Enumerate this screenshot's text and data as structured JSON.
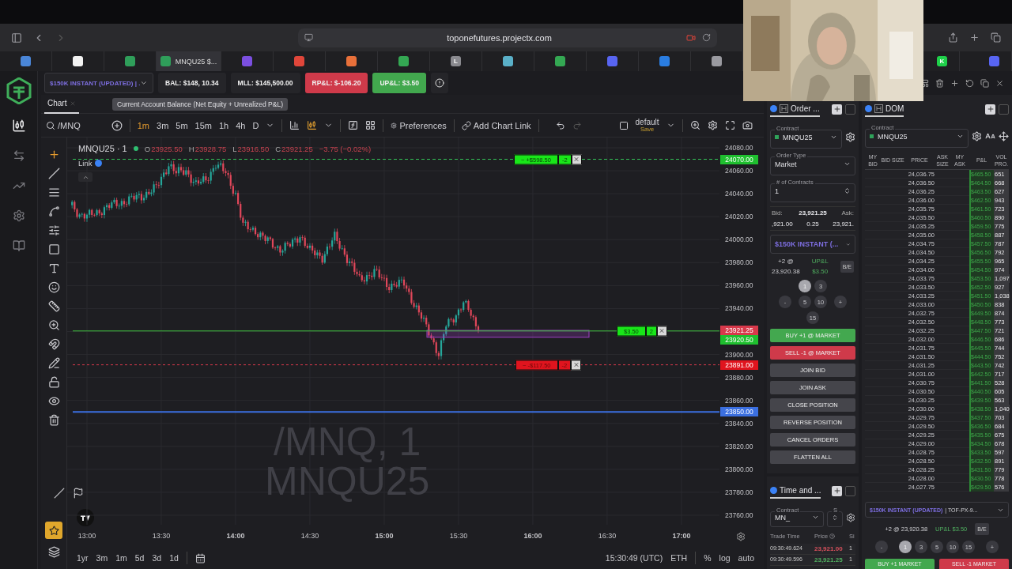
{
  "browser": {
    "url": "toponefutures.projectx.com",
    "tabs": [
      {
        "color": "#4a86d8",
        "selected": false
      },
      {
        "color": "#f2f2f2",
        "selected": false
      },
      {
        "color": "#2f9e5a",
        "selected": false
      },
      {
        "color": "#2f9e5a",
        "label": "MNQU25 $...",
        "selected": true
      },
      {
        "color": "#7b4fe0",
        "selected": false
      },
      {
        "color": "#e0463a",
        "selected": false
      },
      {
        "color": "#e8703a",
        "selected": false
      },
      {
        "color": "#34a853",
        "selected": false
      },
      {
        "color": "#8a8a8f",
        "label": "L",
        "selected": false
      },
      {
        "color": "#5ab0c8",
        "selected": false
      },
      {
        "color": "#34a853",
        "selected": false
      },
      {
        "color": "#5865f2",
        "selected": false
      },
      {
        "color": "#2a7de1",
        "selected": false
      },
      {
        "color": "#9a9aa0",
        "selected": false
      }
    ],
    "pinned_tabs": [
      {
        "color": "#1fd14a",
        "label": "K",
        "selected": false
      },
      {
        "color": "#5865f2",
        "selected": false
      }
    ]
  },
  "account_bar": {
    "account": "$150K INSTANT (UPDATED) | .",
    "stats": [
      {
        "text": "BAL: $148, 10.34",
        "kind": "neutral"
      },
      {
        "text": "MLL: $145,500.00",
        "kind": "neutral"
      },
      {
        "text": "RP&L: $-106.20",
        "kind": "loss"
      },
      {
        "text": "UP&L: $3.50",
        "kind": "profit"
      }
    ]
  },
  "tooltip": "Current Account Balance (Net Equity + Unrealized P&L)",
  "chart": {
    "tab": "Chart",
    "symbol": "/MNQ",
    "timeframes": [
      {
        "label": "1m",
        "selected": true
      },
      {
        "label": "3m",
        "selected": false
      },
      {
        "label": "5m",
        "selected": false
      },
      {
        "label": "15m",
        "selected": false
      },
      {
        "label": "1h",
        "selected": false
      },
      {
        "label": "4h",
        "selected": false
      },
      {
        "label": "D",
        "selected": false
      }
    ],
    "preferences": "Preferences",
    "chart_link": "Add Chart Link",
    "layout": "default",
    "layout_hint": "Save",
    "legend": {
      "title": "MNQU25 · 1",
      "values": [
        {
          "key": "O",
          "value": "23925.50"
        },
        {
          "key": "H",
          "value": "23928.75"
        },
        {
          "key": "L",
          "value": "23916.50"
        },
        {
          "key": "C",
          "value": "23921.25"
        }
      ],
      "change": "−3.75 (−0.02%)",
      "link": "Link"
    },
    "watermark": [
      "/MNQ, 1",
      "MNQU25"
    ],
    "lines": [
      {
        "kind": "target",
        "tag": "24070.00",
        "label": "~ +$598.50",
        "qty": "-2"
      },
      {
        "kind": "last",
        "tag": "23921.25"
      },
      {
        "kind": "position",
        "tag": "23920.50",
        "label": "$3.50",
        "qty": "2"
      },
      {
        "kind": "stop",
        "tag": "23891.00",
        "label": "~ -$117.50",
        "qty": "-2"
      },
      {
        "kind": "level",
        "tag": "23850.00"
      }
    ],
    "price_axis": [
      "24080.00",
      "24060.00",
      "24040.00",
      "24020.00",
      "24000.00",
      "23980.00",
      "23960.00",
      "23940.00",
      "23900.00",
      "23880.00",
      "23860.00",
      "23840.00",
      "23820.00",
      "23800.00",
      "23780.00",
      "23760.00"
    ],
    "time_axis": [
      {
        "label": "13:00",
        "kind": "minor"
      },
      {
        "label": "13:30",
        "kind": "minor"
      },
      {
        "label": "14:00",
        "kind": "major"
      },
      {
        "label": "14:30",
        "kind": "minor"
      },
      {
        "label": "15:00",
        "kind": "major"
      },
      {
        "label": "15:30",
        "kind": "minor"
      },
      {
        "label": "16:00",
        "kind": "major"
      },
      {
        "label": "16:30",
        "kind": "minor"
      },
      {
        "label": "17:00",
        "kind": "major"
      }
    ],
    "ranges": [
      "1yr",
      "3m",
      "1m",
      "5d",
      "3d",
      "1d"
    ],
    "clock": "15:30:49 (UTC)",
    "session": "ETH",
    "scale_options": [
      "%",
      "log",
      "auto"
    ]
  },
  "order": {
    "tab": "Order ...",
    "contract_label": "Contract",
    "contract": "MNQU25",
    "type_label": "Order Type",
    "type": "Market",
    "qty_label": "# of Contracts",
    "qty": "1",
    "bid_label": "Bid:",
    "bid": ",921.00",
    "mid": "23,921.25",
    "spread": "0.25",
    "ask_label": "Ask:",
    "ask": "23,921.",
    "account": "$150K INSTANT (...",
    "position": "+2 @",
    "position_price": "23,920.38",
    "upl_label": "UP&L",
    "upl": "$3.50",
    "breakeven": "B/E",
    "quantities": [
      {
        "label": "1",
        "selected": true
      },
      {
        "label": "3",
        "selected": false
      },
      {
        "label": "5",
        "selected": false
      },
      {
        "label": "10",
        "selected": false
      },
      {
        "label": "15",
        "selected": false
      }
    ],
    "stepper": [
      "-",
      "+"
    ],
    "actions": [
      {
        "label": "BUY +1 @ MARKET",
        "kind": "buy"
      },
      {
        "label": "SELL -1 @ MARKET",
        "kind": "sell"
      },
      {
        "label": "JOIN BID",
        "kind": "plain"
      },
      {
        "label": "JOIN ASK",
        "kind": "plain"
      },
      {
        "label": "CLOSE POSITION",
        "kind": "plain"
      },
      {
        "label": "REVERSE POSITION",
        "kind": "plain"
      },
      {
        "label": "CANCEL ORDERS",
        "kind": "plain"
      },
      {
        "label": "FLATTEN ALL",
        "kind": "plain"
      }
    ]
  },
  "time_and_sales": {
    "tab": "Time and ...",
    "contract_label": "Contract",
    "contract": "MN_",
    "size_label": "S",
    "columns": [
      "Trade Time",
      "Price",
      "Si"
    ],
    "rows": [
      {
        "time": "09:30:49.624",
        "price": "23,921.00",
        "color": "#d8505c",
        "size": "1"
      },
      {
        "time": "09:30:49.596",
        "price": "23,921.25",
        "color": "#4fae5f",
        "size": "1"
      }
    ]
  },
  "dom": {
    "tab": "DOM",
    "contract_label": "Contract",
    "contract": "MNQU25",
    "columns": [
      "MY BID",
      "BID SIZE",
      "PRICE",
      "ASK SIZE",
      "MY ASK",
      "P&L",
      "VOL PRO."
    ],
    "rows": [
      {
        "price": "24,036.75",
        "pnl": "$465.50",
        "volume": "651"
      },
      {
        "price": "24,036.50",
        "pnl": "$464.50",
        "volume": "668"
      },
      {
        "price": "24,036.25",
        "pnl": "$463.50",
        "volume": "627"
      },
      {
        "price": "24,036.00",
        "pnl": "$462.50",
        "volume": "943"
      },
      {
        "price": "24,035.75",
        "pnl": "$461.50",
        "volume": "723"
      },
      {
        "price": "24,035.50",
        "pnl": "$460.50",
        "volume": "890"
      },
      {
        "price": "24,035.25",
        "pnl": "$459.50",
        "volume": "775"
      },
      {
        "price": "24,035.00",
        "pnl": "$458.50",
        "volume": "887"
      },
      {
        "price": "24,034.75",
        "pnl": "$457.50",
        "volume": "787"
      },
      {
        "price": "24,034.50",
        "pnl": "$456.50",
        "volume": "792"
      },
      {
        "price": "24,034.25",
        "pnl": "$455.50",
        "volume": "965"
      },
      {
        "price": "24,034.00",
        "pnl": "$454.50",
        "volume": "974"
      },
      {
        "price": "24,033.75",
        "pnl": "$453.50",
        "volume": "1,097"
      },
      {
        "price": "24,033.50",
        "pnl": "$452.50",
        "volume": "927"
      },
      {
        "price": "24,033.25",
        "pnl": "$451.50",
        "volume": "1,038"
      },
      {
        "price": "24,033.00",
        "pnl": "$450.50",
        "volume": "838"
      },
      {
        "price": "24,032.75",
        "pnl": "$449.50",
        "volume": "874"
      },
      {
        "price": "24,032.50",
        "pnl": "$448.50",
        "volume": "773"
      },
      {
        "price": "24,032.25",
        "pnl": "$447.50",
        "volume": "721"
      },
      {
        "price": "24,032.00",
        "pnl": "$446.50",
        "volume": "686"
      },
      {
        "price": "24,031.75",
        "pnl": "$445.50",
        "volume": "744"
      },
      {
        "price": "24,031.50",
        "pnl": "$444.50",
        "volume": "752"
      },
      {
        "price": "24,031.25",
        "pnl": "$443.50",
        "volume": "742"
      },
      {
        "price": "24,031.00",
        "pnl": "$442.50",
        "volume": "717"
      },
      {
        "price": "24,030.75",
        "pnl": "$441.50",
        "volume": "528"
      },
      {
        "price": "24,030.50",
        "pnl": "$440.50",
        "volume": "605"
      },
      {
        "price": "24,030.25",
        "pnl": "$439.50",
        "volume": "563"
      },
      {
        "price": "24,030.00",
        "pnl": "$438.50",
        "volume": "1,040"
      },
      {
        "price": "24,029.75",
        "pnl": "$437.50",
        "volume": "703"
      },
      {
        "price": "24,029.50",
        "pnl": "$436.50",
        "volume": "684"
      },
      {
        "price": "24,029.25",
        "pnl": "$435.50",
        "volume": "675"
      },
      {
        "price": "24,029.00",
        "pnl": "$434.50",
        "volume": "678"
      },
      {
        "price": "24,028.75",
        "pnl": "$433.50",
        "volume": "597"
      },
      {
        "price": "24,028.50",
        "pnl": "$432.50",
        "volume": "891"
      },
      {
        "price": "24,028.25",
        "pnl": "$431.50",
        "volume": "779"
      },
      {
        "price": "24,028.00",
        "pnl": "$430.50",
        "volume": "778"
      },
      {
        "price": "24,027.75",
        "pnl": "$429.50",
        "volume": "576"
      }
    ],
    "account": "$150K INSTANT (UPDATED)",
    "account_id": "| TOF-PX-9...",
    "position": "+2 @ 23,920.38",
    "upl": "UP&L $3.50",
    "breakeven": "B/E",
    "quantities": [
      {
        "label": "1",
        "selected": true
      },
      {
        "label": "3",
        "selected": false
      },
      {
        "label": "5",
        "selected": false
      },
      {
        "label": "10",
        "selected": false
      },
      {
        "label": "15",
        "selected": false
      }
    ],
    "stepper": [
      "-",
      "+"
    ],
    "actions": [
      {
        "label": "BUY +1 MARKET",
        "kind": "buy"
      },
      {
        "label": "SELL -1 MARKET",
        "kind": "sell"
      }
    ]
  }
}
